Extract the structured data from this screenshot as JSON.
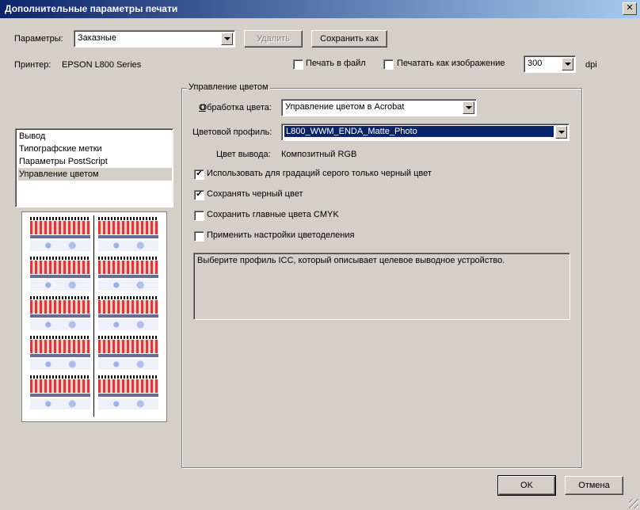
{
  "window": {
    "title": "Дополнительные параметры печати",
    "close_glyph": "✕"
  },
  "params": {
    "label": "Параметры:",
    "value": "Заказные",
    "delete_label": "Удалить",
    "save_as_label": "Сохранить как"
  },
  "printer": {
    "label": "Принтер:",
    "name": "EPSON L800 Series"
  },
  "options": {
    "print_to_file": "Печать в файл",
    "print_as_image": "Печатать как изображение",
    "dpi_value": "300",
    "dpi_unit": "dpi"
  },
  "sidebar": {
    "items": [
      {
        "label": "Вывод"
      },
      {
        "label": "Типографские метки"
      },
      {
        "label": "Параметры PostScript"
      },
      {
        "label": "Управление цветом"
      }
    ]
  },
  "color_mgmt": {
    "group_title": "Управление цветом",
    "handling_label": "Обработка цвета:",
    "handling_value": "Управление цветом в Acrobat",
    "profile_label": "Цветовой профиль:",
    "profile_value": "L800_WWM_ENDA_Matte_Photo",
    "output_label": "Цвет вывода:",
    "output_value": "Композитный RGB",
    "checks": [
      {
        "label": "Использовать для градаций серого только черный цвет",
        "checked": true
      },
      {
        "label": "Сохранять черный цвет",
        "checked": true
      },
      {
        "label": "Сохранить главные цвета CMYK",
        "checked": false
      },
      {
        "label": "Применить настройки цветоделения",
        "checked": false
      }
    ],
    "description": "Выберите профиль ICC, который описывает целевое выводное устройство."
  },
  "footer": {
    "ok_label": "OK",
    "cancel_label": "Отмена"
  },
  "check_glyph": "✔"
}
